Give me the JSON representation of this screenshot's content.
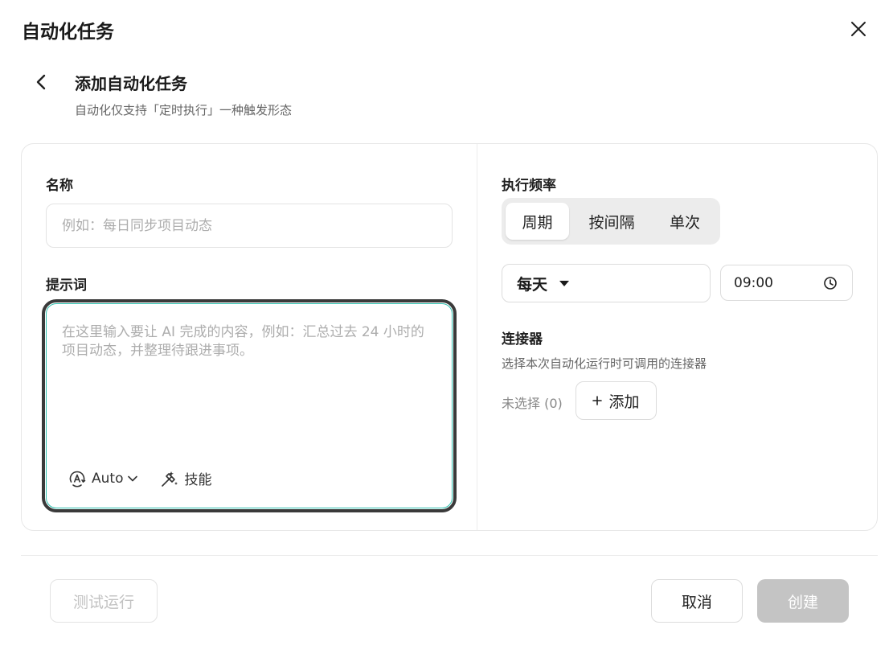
{
  "modal": {
    "title": "自动化任务"
  },
  "header": {
    "title": "添加自动化任务",
    "description": "自动化仅支持「定时执行」一种触发形态"
  },
  "form": {
    "name": {
      "label": "名称",
      "placeholder": "例如：每日同步项目动态",
      "value": ""
    },
    "prompt": {
      "label": "提示词",
      "placeholder": "在这里输入要让 AI 完成的内容，例如：汇总过去 24 小时的项目动态，并整理待跟进事项。",
      "model_label": "Auto",
      "skill_label": "技能"
    }
  },
  "schedule": {
    "label": "执行频率",
    "tabs": [
      {
        "label": "周期",
        "active": true
      },
      {
        "label": "按间隔",
        "active": false
      },
      {
        "label": "单次",
        "active": false
      }
    ],
    "frequency": "每天",
    "time": "09:00"
  },
  "connectors": {
    "label": "连接器",
    "description": "选择本次自动化运行时可调用的连接器",
    "selected_text": "未选择 (0)",
    "add_label": "添加"
  },
  "footer": {
    "test_label": "测试运行",
    "cancel_label": "取消",
    "create_label": "创建"
  },
  "colors": {
    "prompt_focus_outer": "#3a3a3a",
    "prompt_focus_inner": "#2dbfae",
    "create_disabled_bg": "#c4c4c4"
  },
  "icons": [
    "close-icon",
    "back-chevron-icon",
    "auto-model-icon",
    "chevron-down-icon",
    "skill-wand-icon",
    "caret-down-icon",
    "clock-icon",
    "plus-icon"
  ]
}
